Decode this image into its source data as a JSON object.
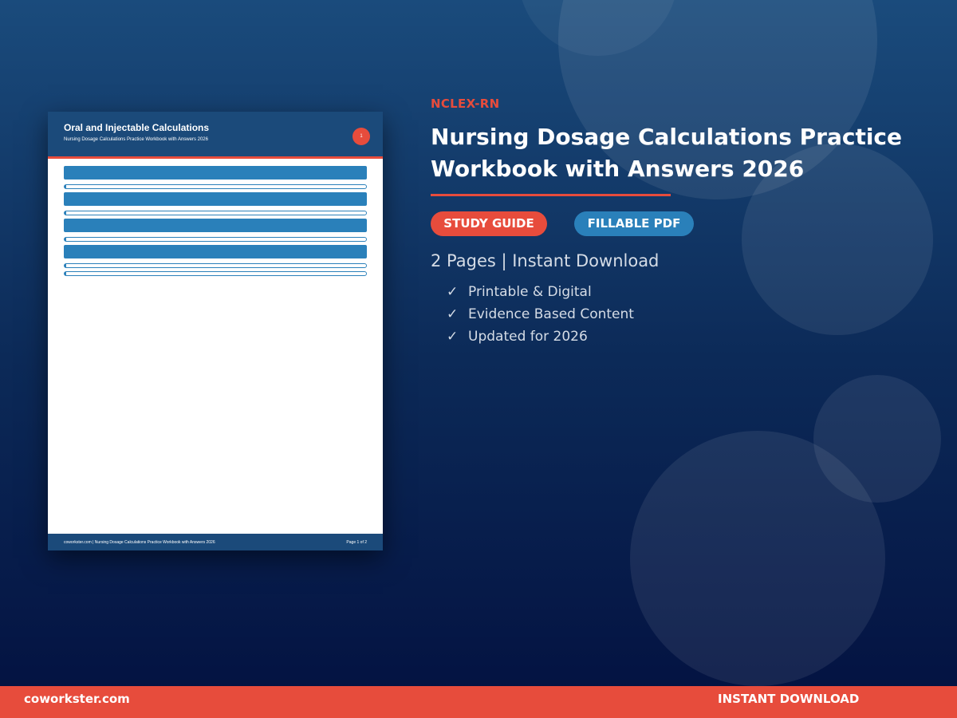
{
  "document": {
    "title": "Oral and Injectable Calculations",
    "subtitle": "Nursing Dosage Calculations Practice Workbook with Answers 2026",
    "page_badge": "1",
    "footer_left": "coworkster.com | Nursing Dosage Calculations Practice Workbook with Answers 2026",
    "footer_right": "Page 1 of 2"
  },
  "product": {
    "category": "NCLEX-RN",
    "title": "Nursing Dosage Calculations Practice Workbook with Answers 2026",
    "badges": [
      "STUDY GUIDE",
      "FILLABLE PDF"
    ],
    "meta": "2 Pages | Instant Download",
    "check_icon": "✓",
    "features": [
      "Printable & Digital",
      "Evidence Based Content",
      "Updated for 2026"
    ]
  },
  "footer": {
    "site": "coworkster.com",
    "cta": "INSTANT DOWNLOAD"
  },
  "colors": {
    "accent": "#e74c3c",
    "blue": "#2a80ba",
    "navy": "#1b4a7a"
  }
}
